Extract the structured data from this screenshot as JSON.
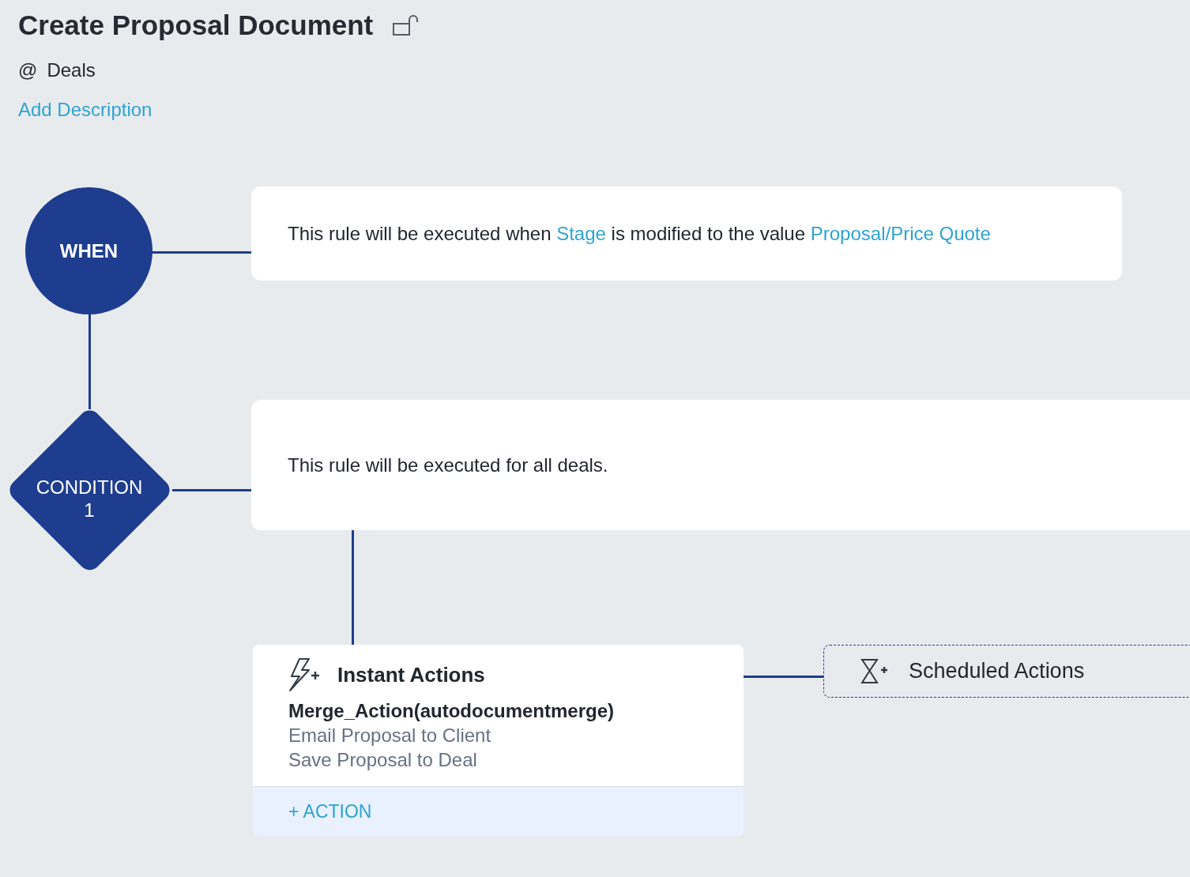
{
  "header": {
    "title": "Create Proposal Document",
    "module_prefix": "@",
    "module": "Deals",
    "add_description": "Add Description"
  },
  "when": {
    "label": "WHEN",
    "sentence": [
      {
        "kind": "text",
        "text": "This rule will be executed when"
      },
      {
        "kind": "link",
        "text": "Stage"
      },
      {
        "kind": "text",
        "text": "is modified to the value"
      },
      {
        "kind": "link",
        "text": "Proposal/Price Quote"
      }
    ]
  },
  "condition": {
    "label": "CONDITION",
    "number": "1",
    "sentence": "This rule will be executed for all deals."
  },
  "instant_actions": {
    "title": "Instant Actions",
    "actions": [
      {
        "kind": "primary",
        "text": "Merge_Action(autodocumentmerge)"
      },
      {
        "kind": "secondary",
        "text": "Email Proposal to Client"
      },
      {
        "kind": "secondary",
        "text": "Save Proposal to Deal"
      }
    ],
    "add_button": "+ ACTION"
  },
  "scheduled_actions": {
    "title": "Scheduled Actions"
  }
}
